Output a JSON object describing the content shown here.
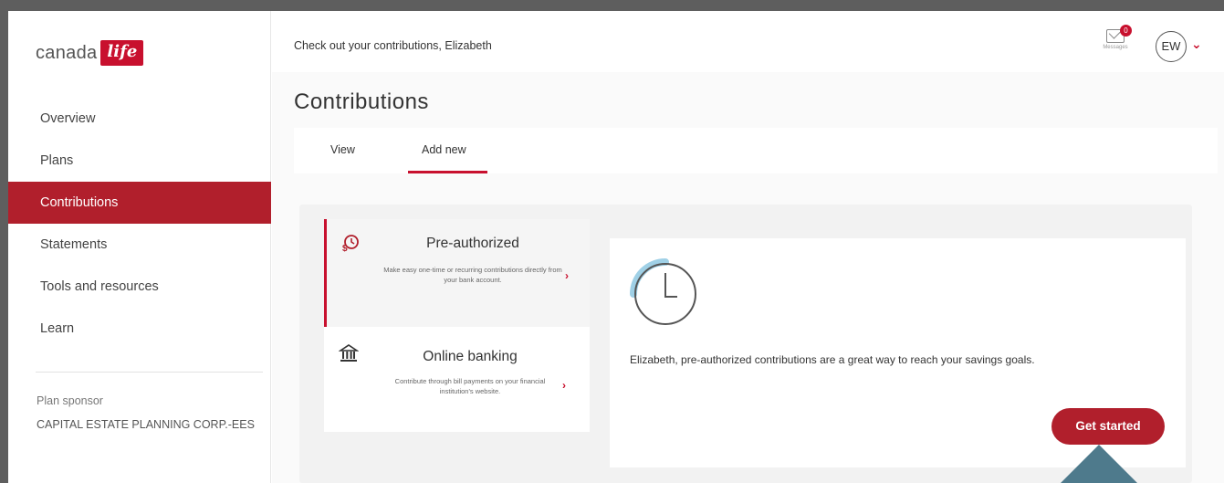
{
  "sidebar": {
    "logo_text": "canada",
    "logo_box": "life",
    "nav": [
      {
        "label": "Overview",
        "active": false
      },
      {
        "label": "Plans",
        "active": false
      },
      {
        "label": "Contributions",
        "active": true
      },
      {
        "label": "Statements",
        "active": false
      },
      {
        "label": "Tools and resources",
        "active": false
      },
      {
        "label": "Learn",
        "active": false
      }
    ],
    "sponsor_label": "Plan sponsor",
    "sponsor_value": "CAPITAL ESTATE PLANNING CORP.-EES"
  },
  "header": {
    "greeting": "Check out your contributions, Elizabeth",
    "messages_badge": "0",
    "messages_label": "Messages",
    "avatar_initials": "EW"
  },
  "page": {
    "title": "Contributions",
    "tabs": [
      {
        "label": "View",
        "active": false
      },
      {
        "label": "Add new",
        "active": true
      }
    ]
  },
  "options": {
    "pre": {
      "title": "Pre-authorized",
      "desc": "Make easy one-time or recurring contributions directly from your bank account.",
      "icon": "clock-dollar-icon"
    },
    "bank": {
      "title": "Online banking",
      "desc": "Contribute through bill payments on your financial institution's website.",
      "icon": "bank-icon"
    }
  },
  "detail": {
    "text": "Elizabeth, pre-authorized contributions are a great way to reach your savings goals.",
    "button": "Get started"
  },
  "colors": {
    "brand_red": "#b11f2c",
    "marker": "#4e7a8c"
  }
}
